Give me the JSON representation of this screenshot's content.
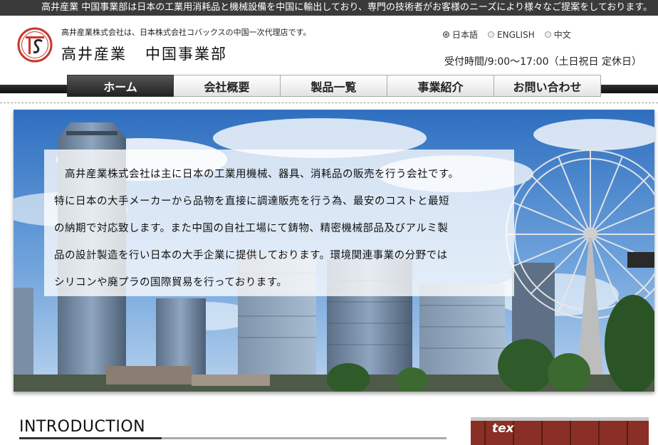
{
  "topbar": {
    "text": "高井産業 中国事業部は日本の工業用消耗品と機械設備を中国に輸出しており、専門の技術者がお客様のニーズにより様々なご提案をしております。"
  },
  "header": {
    "tagline": "高井産業株式会社は、日本株式会社コバックスの中国一次代理店です。",
    "company_name": "高井産業",
    "department": "中国事業部",
    "logo_icon": "ts-monogram-logo",
    "hours": "受付時間/9:00～17:00（土日祝日 定休日）"
  },
  "languages": [
    {
      "label": "日本語",
      "selected": true
    },
    {
      "label": "ENGLISH",
      "selected": false
    },
    {
      "label": "中文",
      "selected": false
    }
  ],
  "nav": [
    {
      "label": "ホーム",
      "active": true
    },
    {
      "label": "会社概要",
      "active": false
    },
    {
      "label": "製品一覧",
      "active": false
    },
    {
      "label": "事業紹介",
      "active": false
    },
    {
      "label": "お問い合わせ",
      "active": false
    }
  ],
  "hero": {
    "lines": [
      "　高井産業株式会社は主に日本の工業用機械、器具、消耗品の販売を行う会社です。",
      "特に日本の大手メーカーから品物を直接に調達販売を行う為、最安のコストと最短",
      "の納期で対応致します。また中国の自社工場にて鋳物、精密機械部品及びアルミ製",
      "品の設計製造を行い日本の大手企業に提供しております。環境関連事業の分野では",
      "シリコンや廃プラの国際貿易を行っております。"
    ]
  },
  "intro": {
    "title": "INTRODUCTION"
  },
  "thumb": {
    "label": "tex"
  },
  "colors": {
    "topbar": "#3a3a3a",
    "nav_active": "#333333",
    "logo_red": "#c8372d"
  }
}
